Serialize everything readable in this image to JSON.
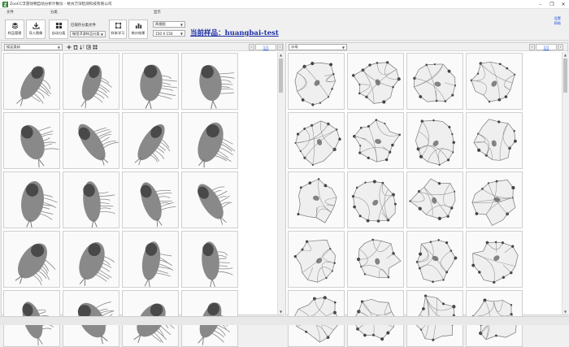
{
  "window": {
    "title": "ZooCC浮游动物自动分析计数仪 - 杭州万深检测科技有限公司",
    "minimize": "–",
    "maximize": "❐",
    "close": "✕"
  },
  "ribbon": {
    "groups": {
      "file": "文件",
      "classify": "分类",
      "display": "显示"
    },
    "buttons": {
      "sample_manage": "样品管理",
      "import_image": "导入图像",
      "auto_classify": "自动分类",
      "sample_learn": "样本学习",
      "stats_result": "统计结果"
    },
    "saved_file_label": "已保存分类文件",
    "template_select": "微型浮游样品分类",
    "view_select": "两视图",
    "size_select": "150 X 150",
    "current_sample": "当前样品：huangbai-test",
    "links": [
      "设置",
      "帮助"
    ]
  },
  "left_panel": {
    "category": "桡足类幼",
    "page": "1/1",
    "prev": "‹",
    "next": "›"
  },
  "right_panel": {
    "category": "水母",
    "page": "1/1",
    "prev": "‹",
    "next": "›"
  },
  "icons": {
    "sample": "layers-icon",
    "import": "download-icon",
    "auto": "grid-icon",
    "learn": "crop-icon",
    "stats": "bar-chart-icon"
  },
  "colors": {
    "accent": "#1c2ea6",
    "link": "#1c4fd6"
  }
}
